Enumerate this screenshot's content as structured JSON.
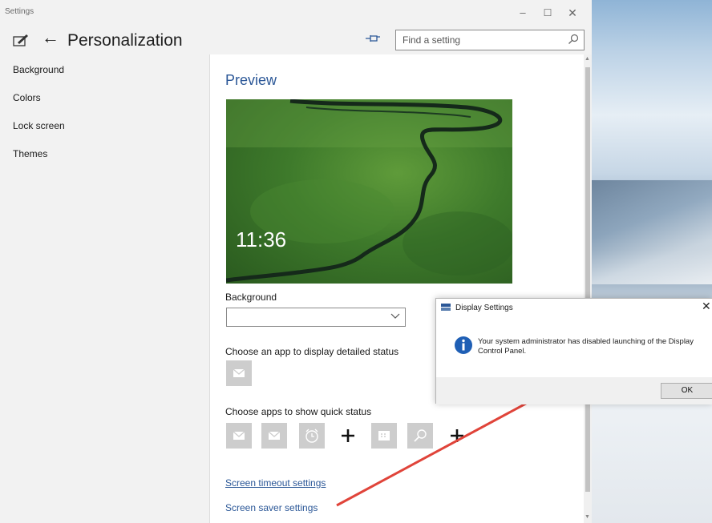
{
  "window": {
    "title": "Settings",
    "controls": {
      "minimize": "–",
      "maximize": "☐",
      "close": "✕"
    }
  },
  "header": {
    "back": "←",
    "page_title": "Personalization",
    "search_placeholder": "Find a setting"
  },
  "sidebar": {
    "items": [
      {
        "label": "Background"
      },
      {
        "label": "Colors"
      },
      {
        "label": "Lock screen"
      },
      {
        "label": "Themes"
      }
    ]
  },
  "main": {
    "preview_heading": "Preview",
    "clock": "11:36",
    "background_label": "Background",
    "background_value": "",
    "detailed_status_label": "Choose an app to display detailed status",
    "quick_status_label": "Choose apps to show quick status",
    "quick_status_icons": [
      "mail-icon",
      "mail-icon",
      "alarm-icon",
      "plus-icon",
      "calendar-icon",
      "search-icon",
      "plus-icon"
    ],
    "links": {
      "screen_timeout": "Screen timeout settings",
      "screen_saver": "Screen saver settings"
    }
  },
  "dialog": {
    "title": "Display Settings",
    "close": "✕",
    "message": "Your system administrator has disabled launching of the Display Control Panel.",
    "ok_label": "OK"
  },
  "colors": {
    "accent": "#2b5797",
    "annotation_arrow": "#e0443a",
    "tile": "#cdcdcd"
  }
}
